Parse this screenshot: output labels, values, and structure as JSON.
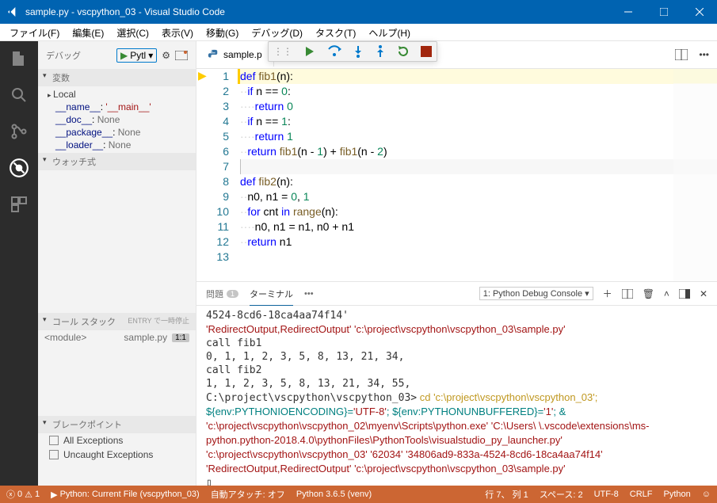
{
  "title": "sample.py - vscpython_03 - Visual Studio Code",
  "menu": [
    "ファイル(F)",
    "編集(E)",
    "選択(C)",
    "表示(V)",
    "移動(G)",
    "デバッグ(D)",
    "タスク(T)",
    "ヘルプ(H)"
  ],
  "sidebar": {
    "debug_label": "デバッグ",
    "config": "Pytl",
    "sections": {
      "vars": "変数",
      "local": "Local",
      "watch": "ウォッチ式",
      "callstack": "コール スタック",
      "callstack_hint": "ENTRY で一時停止",
      "breakpoints": "ブレークポイント"
    },
    "local_vars": [
      {
        "name": "__name__",
        "val": "'__main__'",
        "c": "red"
      },
      {
        "name": "__doc__",
        "val": "None",
        "c": "gray"
      },
      {
        "name": "__package__",
        "val": "None",
        "c": "gray"
      },
      {
        "name": "__loader__",
        "val": "None",
        "c": "gray"
      }
    ],
    "stack": {
      "mod": "<module>",
      "file": "sample.py",
      "line": "1:1"
    },
    "bp": [
      "All Exceptions",
      "Uncaught Exceptions"
    ]
  },
  "tab": {
    "name": "sample.p"
  },
  "code_lines": [
    "def fib1(n):",
    "  if n == 0:",
    "    return 0",
    "  if n == 1:",
    "    return 1",
    "  return fib1(n - 1) + fib1(n - 2)",
    "",
    "def fib2(n):",
    "  n0, n1 = 0, 1",
    "  for cnt in range(n):",
    "    n0, n1 = n1, n0 + n1",
    "  return n1",
    ""
  ],
  "panel": {
    "tabs": {
      "problems": "問題",
      "problems_badge": "1",
      "terminal": "ターミナル",
      "more": "•••"
    },
    "dropdown": "1: Python Debug Console",
    "term_lines": [
      {
        "t": "plain",
        "s": "4524-8cd6-18ca4aa74f14' "
      },
      {
        "t": "str",
        "s": "'RedirectOutput,RedirectOutput' 'c:\\project\\vscpython\\vscpython_03\\sample.py'"
      },
      {
        "t": "plain",
        "s": "call fib1"
      },
      {
        "t": "plain",
        "s": "0, 1, 1, 2, 3, 5, 8, 13, 21, 34,"
      },
      {
        "t": "plain",
        "s": "call fib2"
      },
      {
        "t": "plain",
        "s": "1, 1, 2, 3, 5, 8, 13, 21, 34, 55,"
      },
      {
        "t": "prompt",
        "s": "C:\\project\\vscpython\\vscpython_03>",
        "cmd": " cd 'c:\\project\\vscpython\\vscpython_03';"
      },
      {
        "t": "env",
        "s": "${env:PYTHONIOENCODING}='UTF-8'; ${env:PYTHONUNBUFFERED}='1'; & 'c:\\project\\vscpython\\vscpython_02\\myenv\\Scripts\\python.exe' 'C:\\Users\\       \\.vscode\\extensions\\ms-python.python-2018.4.0\\pythonFiles\\PythonTools\\visualstudio_py_launcher.py' 'c:\\project\\vscpython\\vscpython_03' '62034' '34806ad9-833a-4524-8cd6-18ca4aa74f14' 'RedirectOutput,RedirectOutput' 'c:\\project\\vscpython\\vscpython_03\\sample.py'"
      },
      {
        "t": "cursor",
        "s": "▯"
      }
    ]
  },
  "status": {
    "errors": "0",
    "warnings": "1",
    "launch": "Python: Current File (vscpython_03)",
    "attach": "自動アタッチ: オフ",
    "venv": "Python 3.6.5 (venv)",
    "pos": "行 7、 列 1",
    "spaces": "スペース: 2",
    "enc": "UTF-8",
    "eol": "CRLF",
    "lang": "Python"
  }
}
